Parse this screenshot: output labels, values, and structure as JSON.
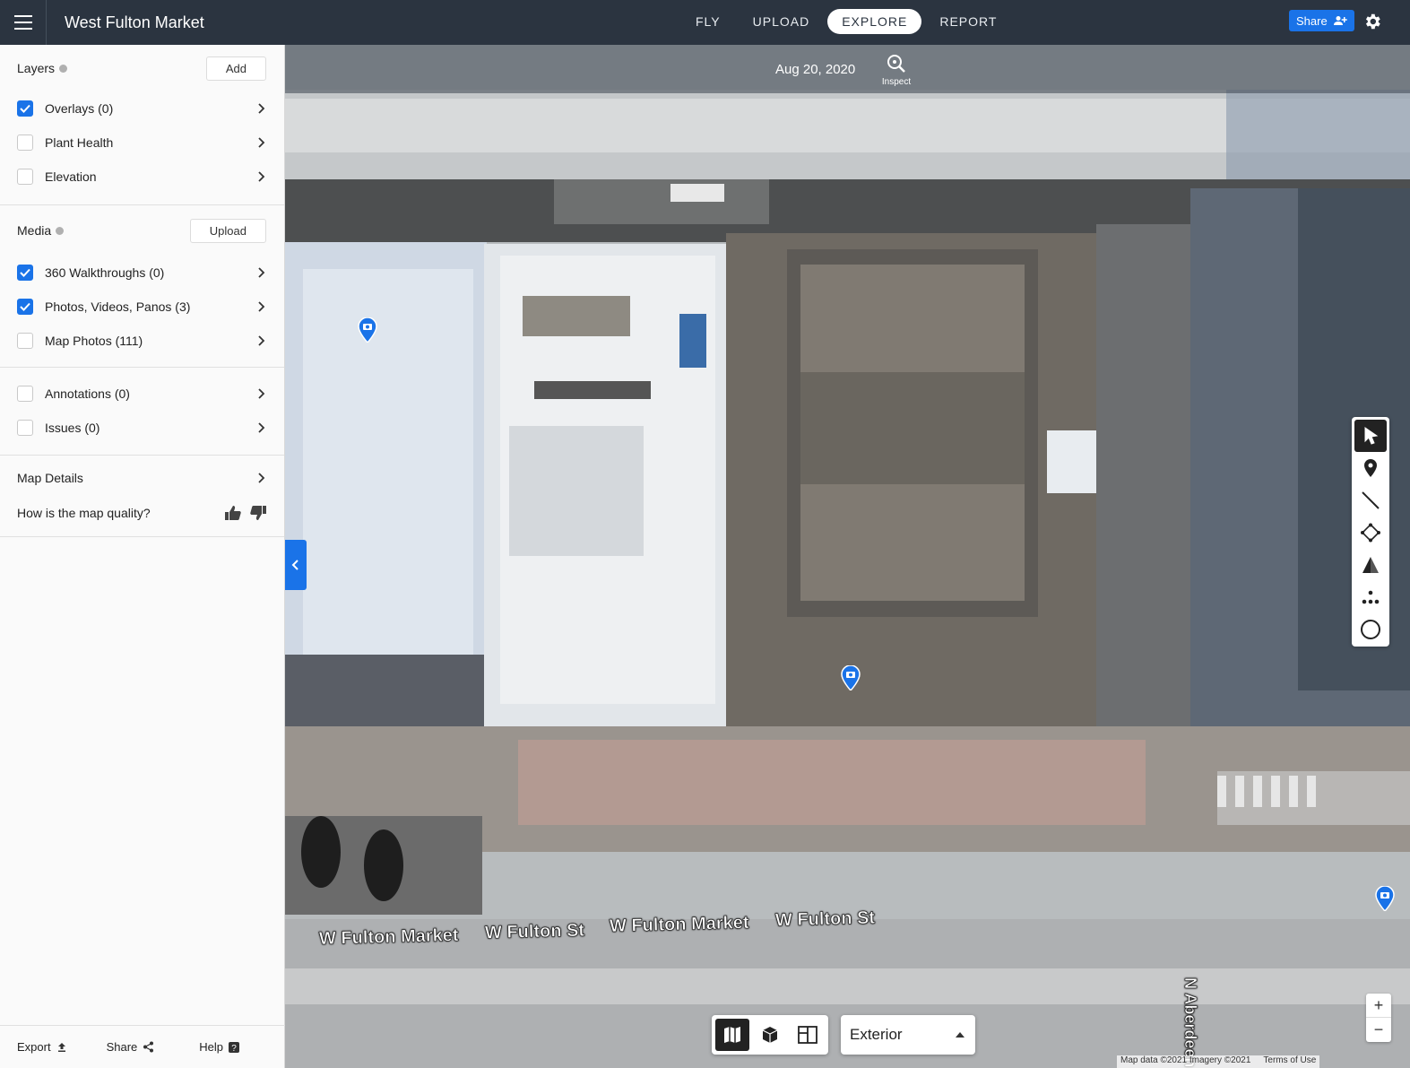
{
  "app": {
    "title": "West Fulton Market"
  },
  "nav": {
    "items": [
      "FLY",
      "UPLOAD",
      "EXPLORE",
      "REPORT"
    ],
    "active": "EXPLORE"
  },
  "header": {
    "share_label": "Share"
  },
  "layers": {
    "title": "Layers",
    "add_label": "Add",
    "items": [
      {
        "label": "Overlays (0)",
        "checked": true
      },
      {
        "label": "Plant Health",
        "checked": false
      },
      {
        "label": "Elevation",
        "checked": false
      }
    ]
  },
  "media": {
    "title": "Media",
    "upload_label": "Upload",
    "items": [
      {
        "label": "360 Walkthroughs (0)",
        "checked": true
      },
      {
        "label": "Photos, Videos, Panos (3)",
        "checked": true
      },
      {
        "label": "Map Photos (111)",
        "checked": false
      }
    ]
  },
  "extras": {
    "items": [
      {
        "label": "Annotations (0)",
        "checked": false
      },
      {
        "label": "Issues (0)",
        "checked": false
      }
    ]
  },
  "details": {
    "label": "Map Details",
    "quality_question": "How is the map quality?"
  },
  "footer": {
    "export_label": "Export",
    "share_label": "Share",
    "help_label": "Help"
  },
  "map": {
    "date": "Aug 20, 2020",
    "inspect_label": "Inspect",
    "view_select": "Exterior",
    "attribution": "Map data ©2021 Imagery ©2021",
    "terms": "Terms of Use",
    "streets": [
      "W Fulton Market",
      "W Fulton St",
      "W Fulton Market",
      "W Fulton St",
      "N Aberdeen St"
    ]
  },
  "colors": {
    "topbar": "#2b3440",
    "accent": "#1a73e8"
  }
}
